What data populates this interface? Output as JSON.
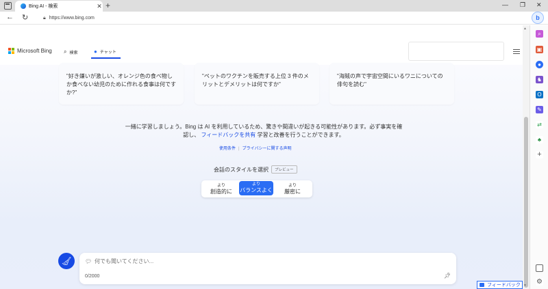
{
  "browser": {
    "tab_title": "Bing AI - 検索",
    "tab_close": "✕",
    "new_tab": "+",
    "url": "https://www.bing.com",
    "window_minimize": "—",
    "window_restore": "❐",
    "window_close": "✕"
  },
  "header": {
    "brand": "Microsoft Bing",
    "search_tab": "検索",
    "chat_tab": "チャット"
  },
  "suggestions": [
    "\"好き嫌いが激しい、オレンジ色の食べ物しか食べない幼児のために作れる食事は何ですか?\"",
    "\"ペットのワクチンを販売する上位 3 件のメリットとデメリットは何ですか\"",
    "\"海賊の声で宇宙空間にいるワニについての俳句を読む\""
  ],
  "disclaimer": {
    "before": "一緒に学習しましょう。Bing は AI を利用しているため、驚きや間違いが起きる可能性があります。必ず事実を確認し、",
    "link": "フィードバックを共有",
    "after": "学習と改善を行うことができます。"
  },
  "links": {
    "terms": "使用条件",
    "privacy": "プライバシーに関する声明"
  },
  "style": {
    "title": "会話のスタイルを選択",
    "badge": "プレビュー",
    "options": [
      {
        "small": "より",
        "big": "創造的に"
      },
      {
        "small": "より",
        "big": "バランスよく"
      },
      {
        "small": "より",
        "big": "厳密に"
      }
    ],
    "selected": "バランスよく"
  },
  "input": {
    "placeholder": "何でも聞いてください...",
    "counter": "0/2000"
  },
  "feedback": "フィードバック",
  "colors": {
    "accent": "#174ae4",
    "selected_style": "#2a6df4"
  }
}
